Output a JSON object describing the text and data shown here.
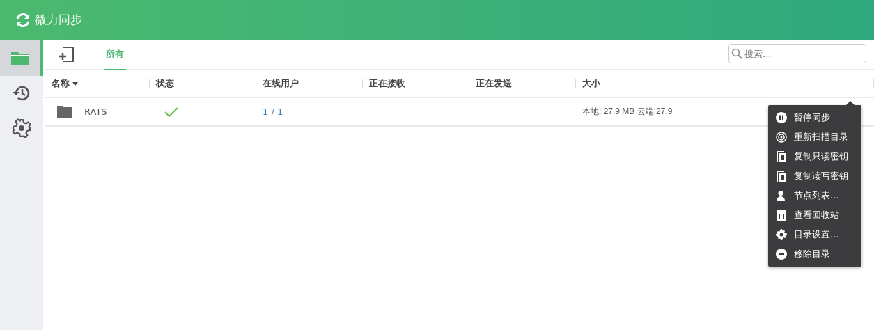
{
  "app": {
    "title": "微力同步"
  },
  "sidebar": {
    "items": [
      {
        "kind": "folders",
        "selected": true
      },
      {
        "kind": "history",
        "selected": false
      },
      {
        "kind": "settings",
        "selected": false
      }
    ]
  },
  "toolbar": {
    "tabs": [
      {
        "label": "所有",
        "selected": true
      }
    ],
    "search": {
      "placeholder": "搜索..."
    }
  },
  "table": {
    "columns": [
      "名称",
      "状态",
      "在线用户",
      "正在接收",
      "正在发送",
      "大小"
    ],
    "rows": [
      {
        "name": "RATS",
        "synced": true,
        "online": "1 / 1",
        "receiving": "",
        "sending": "",
        "size": "本地: 27.9 MB 云端:27.9"
      }
    ]
  },
  "context_menu": {
    "items": [
      {
        "kind": "pause",
        "label": "暂停同步"
      },
      {
        "kind": "scan",
        "label": "重新扫描目录"
      },
      {
        "kind": "copy",
        "label": "复制只读密钥"
      },
      {
        "kind": "copy",
        "label": "复制读写密钥"
      },
      {
        "kind": "nodes",
        "label": "节点列表..."
      },
      {
        "kind": "trash",
        "label": "查看回收站"
      },
      {
        "kind": "gear",
        "label": "目录设置..."
      },
      {
        "kind": "remove",
        "label": "移除目录"
      }
    ]
  }
}
